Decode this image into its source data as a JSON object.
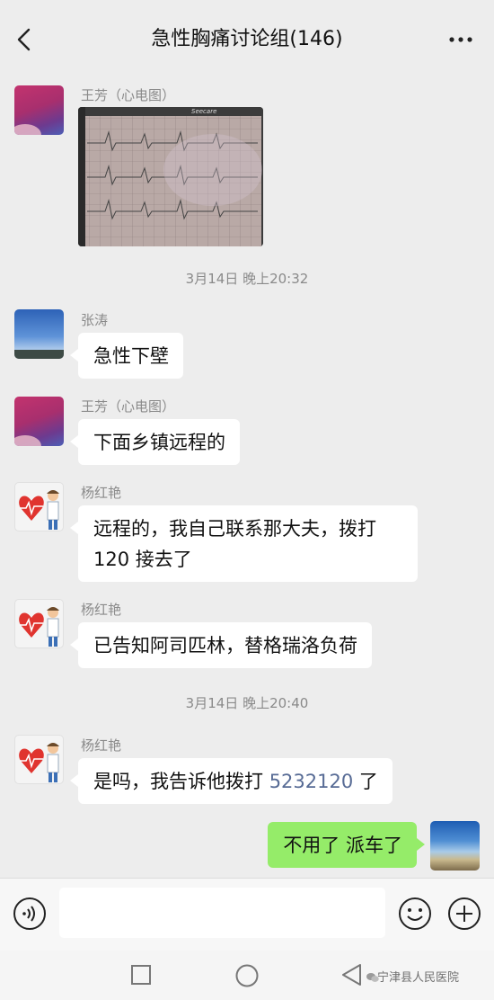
{
  "header": {
    "title": "急性胸痛讨论组(146)"
  },
  "messages": [
    {
      "sender": "王芳（心电图）"
    },
    {
      "sender": "张涛",
      "text": "急性下壁"
    },
    {
      "sender": "王芳（心电图）",
      "text": "下面乡镇远程的"
    },
    {
      "sender": "杨红艳",
      "text_line1": "远程的，我自己联系那大夫，拨打",
      "text_line2": "120 接去了"
    },
    {
      "sender": "杨红艳",
      "text": "已告知阿司匹林，替格瑞洛负荷"
    },
    {
      "sender": "杨红艳",
      "text_before": "是吗，我告诉他拨打 ",
      "phone": "5232120",
      "text_after": " 了"
    },
    {
      "sender": "me",
      "text": "不用了 派车了"
    }
  ],
  "timestamps": [
    "3月14日 晚上20:32",
    "3月14日 晚上20:40"
  ],
  "image_caption": "Seecare",
  "watermark": "宁津县人民医院",
  "colors": {
    "self_bubble": "#95ec69",
    "other_bubble": "#ffffff",
    "link": "#576b95",
    "background": "#ededed"
  }
}
